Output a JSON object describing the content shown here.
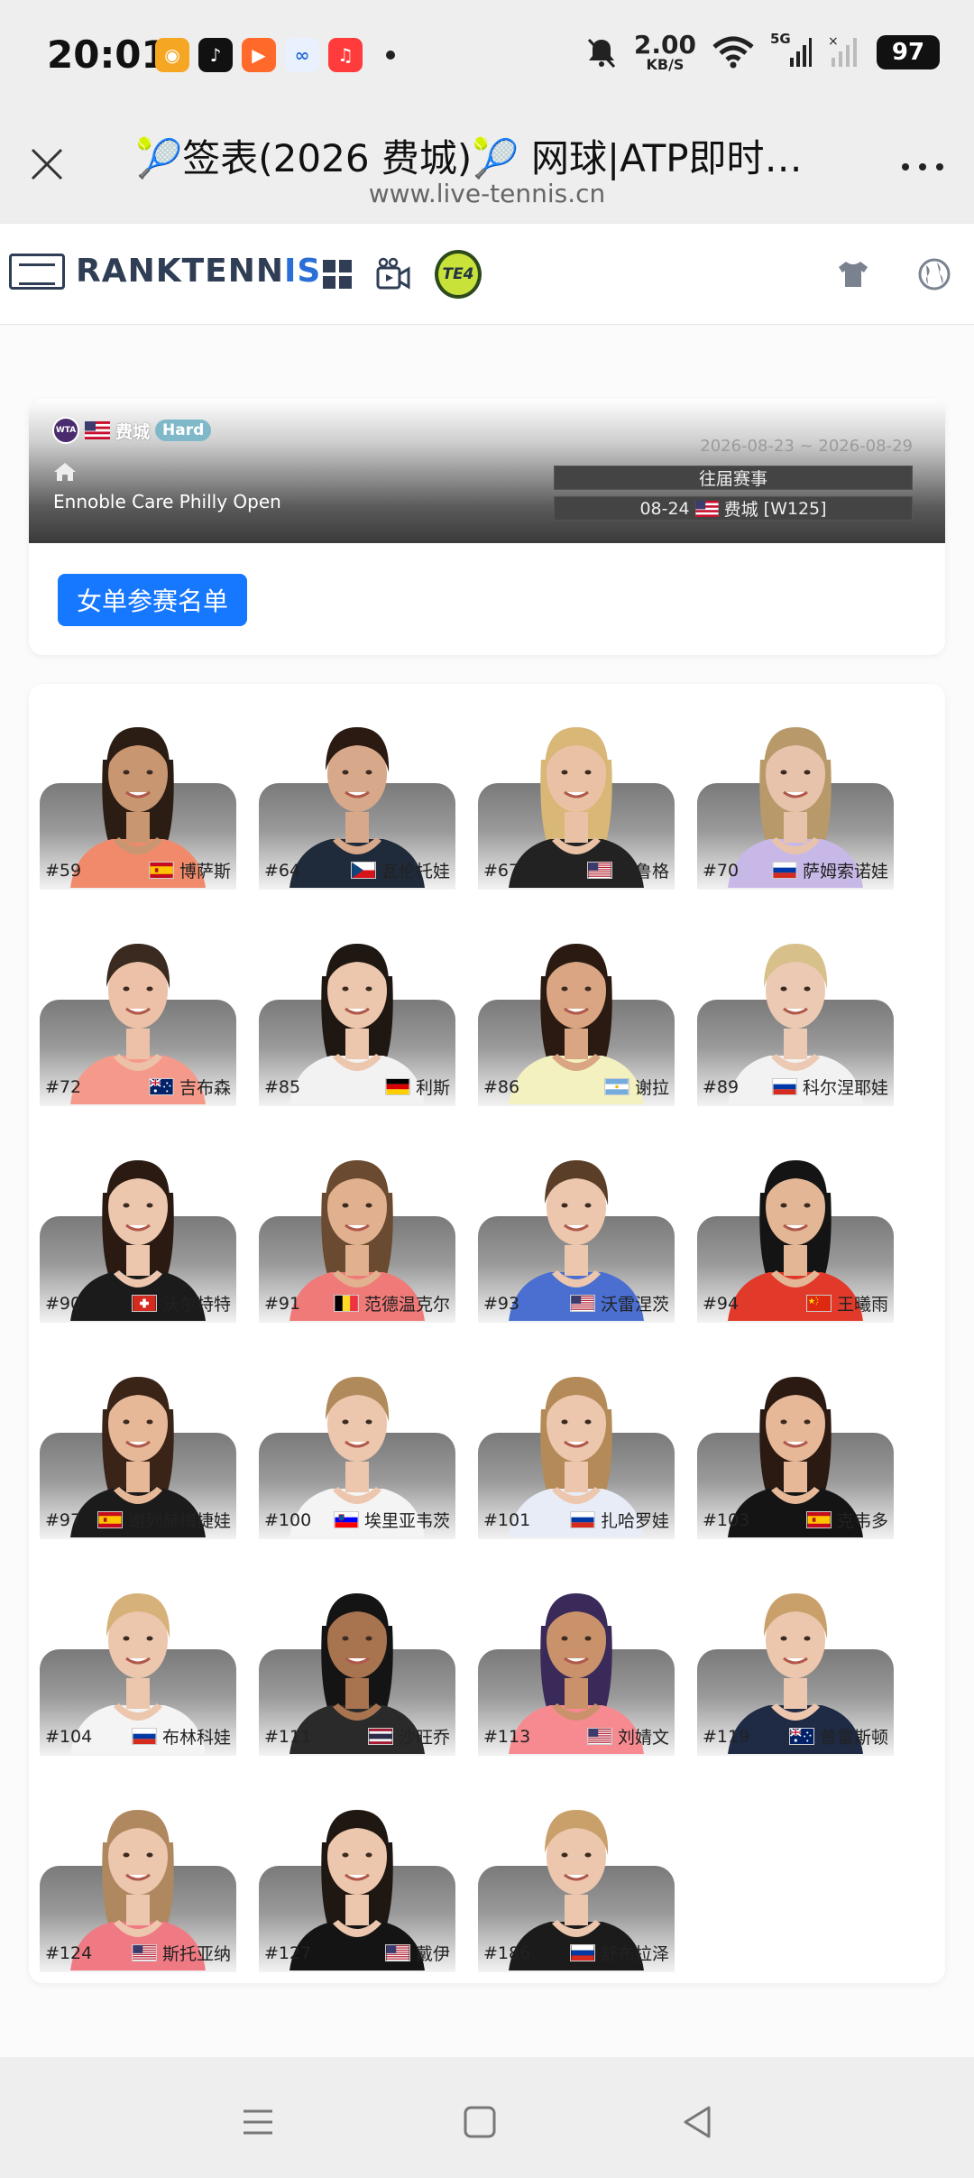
{
  "status_bar": {
    "time": "20:01",
    "speed_value": "2.00",
    "speed_unit": "KB/S",
    "network": "5G",
    "battery": "97",
    "notification_icons": [
      "weibo-icon",
      "douyin-icon",
      "kuaishou-icon",
      "baidu-netdisk-icon",
      "music-icon"
    ]
  },
  "browser": {
    "title": "🎾签表(2026 费城)🎾 网球|ATP即时排名",
    "url": "www.live-tennis.cn"
  },
  "site_nav": {
    "logo_part1": "RANKTENN",
    "logo_part2": "IS",
    "te4_label": "TE4"
  },
  "event": {
    "city": "费城",
    "surface": "Hard",
    "tournament_name": "Ennoble Care Philly Open",
    "dates": "2026-08-23 ~ 2026-08-29",
    "past_events_label": "往届赛事",
    "edition_date": "08-24",
    "edition_city": "费城",
    "edition_tier": "[W125]",
    "entry_list_button": "女单参赛名单"
  },
  "players": [
    {
      "rank": "#59",
      "country": "ESP",
      "name": "博萨斯",
      "shirt": "#f08a6a",
      "hair": "#2b1d14",
      "skin": "#c99672"
    },
    {
      "rank": "#64",
      "country": "CZE",
      "name": "瓦伦托娃",
      "shirt": "#1f2a3a",
      "hair": "#2a1a12",
      "skin": "#d7a98a"
    },
    {
      "rank": "#67",
      "country": "USA",
      "name": "克鲁格",
      "shirt": "#222222",
      "hair": "#d9b777",
      "skin": "#e9c2a6"
    },
    {
      "rank": "#70",
      "country": "RUS",
      "name": "萨姆索诺娃",
      "shirt": "#c8b8e8",
      "hair": "#b89a6a",
      "skin": "#e8c3ac"
    },
    {
      "rank": "#72",
      "country": "AUS",
      "name": "吉布森",
      "shirt": "#f59a8a",
      "hair": "#3a2a20",
      "skin": "#ecc1a8"
    },
    {
      "rank": "#85",
      "country": "GER",
      "name": "利斯",
      "shirt": "#f2f2f2",
      "hair": "#1f1712",
      "skin": "#ecc6ad"
    },
    {
      "rank": "#86",
      "country": "ARG",
      "name": "谢拉",
      "shirt": "#f4f1c0",
      "hair": "#2a1a12",
      "skin": "#d9a583"
    },
    {
      "rank": "#89",
      "country": "RUS",
      "name": "科尔涅耶娃",
      "shirt": "#f2f2f2",
      "hair": "#d8c08a",
      "skin": "#ecc9b2"
    },
    {
      "rank": "#90",
      "country": "SUI",
      "name": "沃尔特特",
      "shirt": "#1b1b1b",
      "hair": "#2a1a12",
      "skin": "#ecc6ad"
    },
    {
      "rank": "#91",
      "country": "BEL",
      "name": "范德温克尔",
      "shirt": "#f07a78",
      "hair": "#6a4a30",
      "skin": "#e1b18f"
    },
    {
      "rank": "#93",
      "country": "USA",
      "name": "沃雷涅茨",
      "shirt": "#4a6fd0",
      "hair": "#5a3e28",
      "skin": "#ecc6ad"
    },
    {
      "rank": "#94",
      "country": "CHN",
      "name": "王曦雨",
      "shirt": "#e23a2a",
      "hair": "#141414",
      "skin": "#e3b795"
    },
    {
      "rank": "#97",
      "country": "ESP",
      "name": "谢列赫梅捷娃",
      "shirt": "#1b1b1b",
      "hair": "#3a2418",
      "skin": "#e6b898"
    },
    {
      "rank": "#100",
      "country": "SLO",
      "name": "埃里亚韦茨",
      "shirt": "#f4f4f4",
      "hair": "#b08a5a",
      "skin": "#ecc6ad"
    },
    {
      "rank": "#101",
      "country": "RUS",
      "name": "扎哈罗娃",
      "shirt": "#e8ecf7",
      "hair": "#b48a58",
      "skin": "#ecc6ad"
    },
    {
      "rank": "#103",
      "country": "ESP",
      "name": "克韦多",
      "shirt": "#141414",
      "hair": "#2a1a12",
      "skin": "#e6b898"
    },
    {
      "rank": "#104",
      "country": "RUS",
      "name": "布林科娃",
      "shirt": "#f4f4f4",
      "hair": "#d6b27a",
      "skin": "#ecc6ad"
    },
    {
      "rank": "#111",
      "country": "THA",
      "name": "沙旺乔",
      "shirt": "#2a2a2a",
      "hair": "#141414",
      "skin": "#a8734f"
    },
    {
      "rank": "#113",
      "country": "USA",
      "name": "刘婧文",
      "shirt": "#f78a90",
      "hair": "#3a2a5a",
      "skin": "#c9926a"
    },
    {
      "rank": "#119",
      "country": "AUS",
      "name": "普雷斯顿",
      "shirt": "#1f2a44",
      "hair": "#c9a06a",
      "skin": "#ecc6ad"
    },
    {
      "rank": "#124",
      "country": "USA",
      "name": "斯托亚纳",
      "shirt": "#f07a84",
      "hair": "#b08860",
      "skin": "#ecc6ad"
    },
    {
      "rank": "#127",
      "country": "USA",
      "name": "戴伊",
      "shirt": "#141414",
      "hair": "#1f1712",
      "skin": "#ecc6ad"
    },
    {
      "rank": "#186",
      "country": "RUS",
      "name": "舒布拉泽",
      "shirt": "#1b1b1b",
      "hair": "#c9a06a",
      "skin": "#ecc6ad"
    }
  ],
  "colors": {
    "accent_button": "#1677ff",
    "logo_dark": "#2f3d55",
    "logo_blue": "#2a6fd8",
    "surface_badge": "#7fb8c8"
  }
}
